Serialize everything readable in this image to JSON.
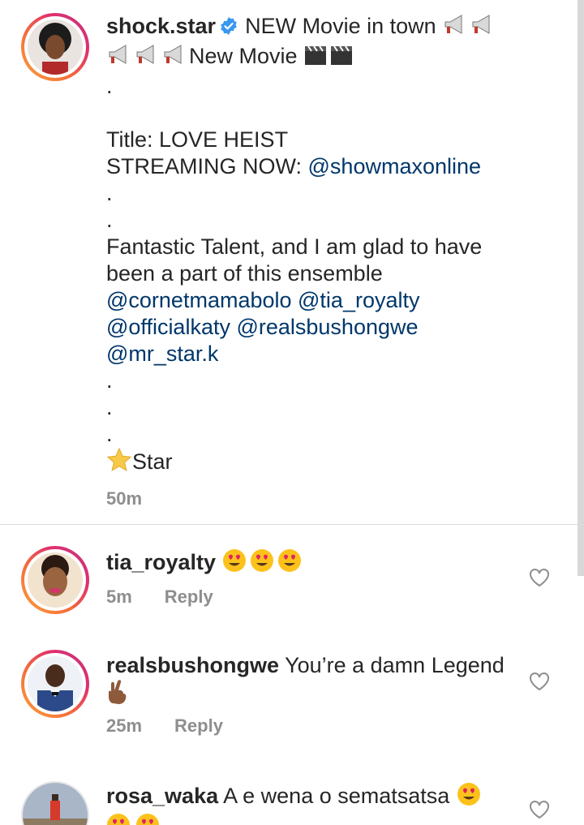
{
  "post": {
    "username": "shock.star",
    "headline_1": "NEW Movie in town",
    "headline_2": "New Movie",
    "dot": ".",
    "title_line": "Title: LOVE HEIST",
    "streaming_prefix": "STREAMING NOW: ",
    "streaming_mention": "@showmaxonline",
    "body_1": "Fantastic Talent, and I am glad to have",
    "body_2": "been a part of this ensemble",
    "mentions_1": "@cornetmamabolo @tia_royalty",
    "mentions_2": "@officialkaty @realsbushongwe",
    "mentions_3": "@mr_star.k",
    "signature": "Star",
    "time": "50m"
  },
  "comments": [
    {
      "username": "tia_royalty",
      "text": "",
      "time": "5m",
      "reply": "Reply"
    },
    {
      "username": "realsbushongwe",
      "text": "You’re a damn Legend",
      "time": "25m",
      "reply": "Reply"
    },
    {
      "username": "rosa_waka",
      "text": "A e wena o sematsatsa",
      "time": "",
      "reply": ""
    }
  ],
  "colors": {
    "mention": "#00376b",
    "meta": "#8e8e8e",
    "verified": "#3897f0"
  },
  "icons": [
    "verified-badge-icon",
    "megaphone-icon",
    "clapper-board-icon",
    "star-icon",
    "heart-eyes-emoji",
    "crossed-fingers-emoji",
    "heart-icon"
  ]
}
